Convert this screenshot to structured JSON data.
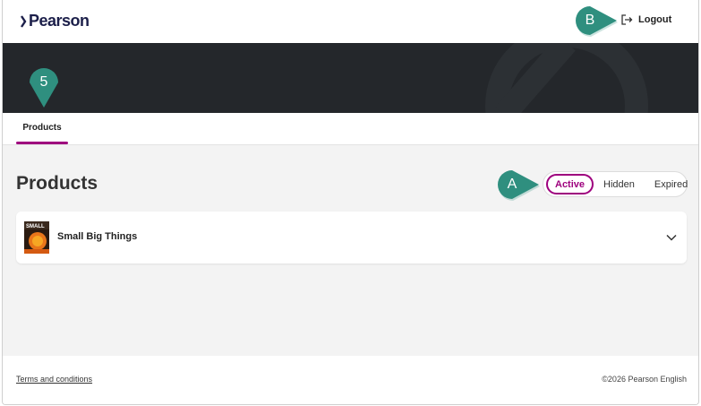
{
  "header": {
    "logo_text": "Pearson",
    "logout_label": "Logout"
  },
  "markers": {
    "b": "B",
    "five": "5",
    "a": "A"
  },
  "tabs": [
    {
      "label": "Products",
      "active": true
    }
  ],
  "main": {
    "title": "Products",
    "filter_options": [
      "Active",
      "Hidden",
      "Expired"
    ],
    "selected_filter": "Active",
    "products": [
      {
        "name": "Small Big Things",
        "cover_text": "SMALL"
      }
    ]
  },
  "footer": {
    "terms": "Terms and conditions",
    "copyright": "©2026 Pearson English"
  },
  "colors": {
    "accent": "#9e007e",
    "brand_navy": "#1c1f4a",
    "banner": "#24272b",
    "marker": "#2f8f7f"
  },
  "icons": {
    "logout": "logout-icon",
    "chevron": "chevron-down-icon",
    "logo": "pearson-logo-icon"
  }
}
